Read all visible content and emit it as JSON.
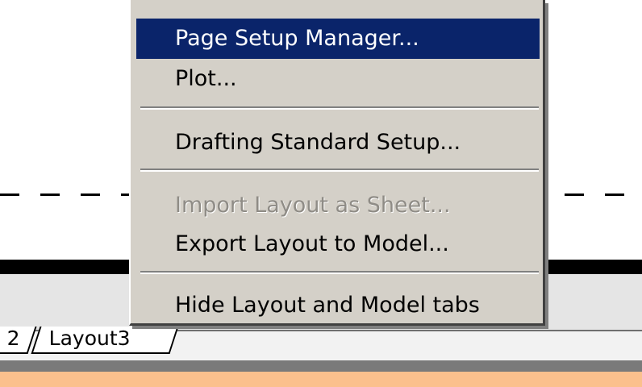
{
  "menu": {
    "items": [
      {
        "label": "Page Setup Manager...",
        "state": "selected"
      },
      {
        "label": "Plot...",
        "state": "normal"
      },
      {
        "label": "Drafting Standard Setup...",
        "state": "normal"
      },
      {
        "label": "Import Layout as Sheet...",
        "state": "disabled"
      },
      {
        "label": "Export Layout to Model...",
        "state": "normal"
      },
      {
        "label": "Hide Layout and Model tabs",
        "state": "normal"
      }
    ]
  },
  "tabs": [
    {
      "label": "2"
    },
    {
      "label": "Layout3"
    }
  ],
  "colors": {
    "menu_bg": "#d4d0c8",
    "highlight": "#0a246a",
    "disabled_text": "#8f8c86",
    "status_bar": "#fbc08d"
  }
}
